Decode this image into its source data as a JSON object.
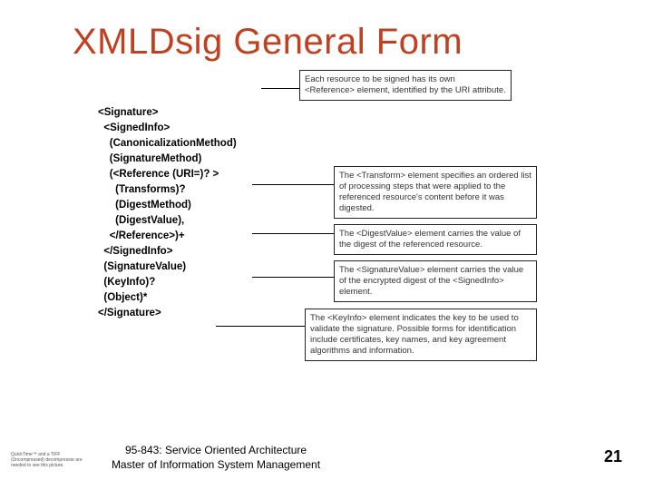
{
  "title": "XMLDsig General Form",
  "code": {
    "l1": "<Signature>",
    "l2": "  <SignedInfo>",
    "l3": "    (CanonicalizationMethod)",
    "l4": "    (SignatureMethod)",
    "l5": "    (<Reference (URI=)? >",
    "l6": "      (Transforms)?",
    "l7": "      (DigestMethod)",
    "l8": "      (DigestValue),",
    "l9": "    </Reference>)+",
    "l10": "  </SignedInfo>",
    "l11": "  (SignatureValue)",
    "l12": "  (KeyInfo)?",
    "l13": "  (Object)*",
    "l14": "</Signature>"
  },
  "callouts": {
    "c1": "Each resource to be signed has its own <Reference> element, identified by the URI attribute.",
    "c2": "The <Transform> element specifies an ordered list of processing steps that were applied to the referenced resource's content before it was digested.",
    "c3": "The <DigestValue> element carries the value of the digest of the referenced resource.",
    "c4": "The <SignatureValue> element carries the value of the encrypted digest of the <SignedInfo> element.",
    "c5": "The <KeyInfo> element indicates the key to be used to validate the signature. Possible forms for identification include certificates, key names, and key agreement algorithms and information."
  },
  "footer": {
    "course": "95-843: Service Oriented Architecture",
    "dept": "Master of Information System Management"
  },
  "tiny": "QuickTime™ and a TIFF (Uncompressed) decompressor are needed to see this picture.",
  "page": "21"
}
